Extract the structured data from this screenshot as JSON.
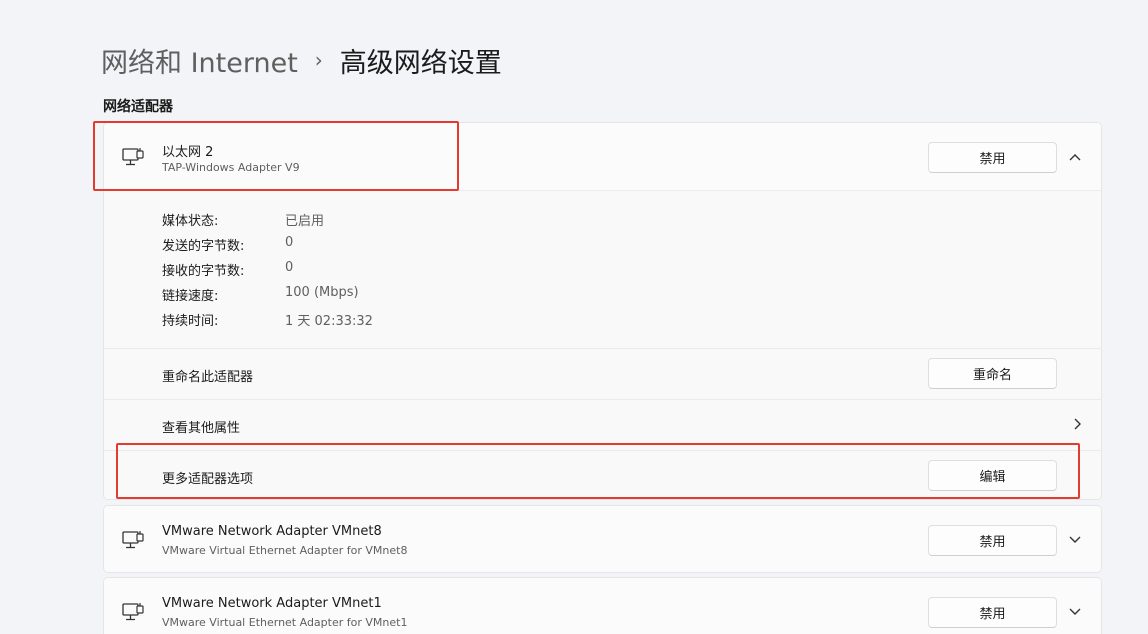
{
  "breadcrumb": {
    "parent": "网络和 Internet",
    "separator": "›",
    "current": "高级网络设置"
  },
  "section_title": "网络适配器",
  "adapters": [
    {
      "name": "以太网 2",
      "description": "TAP-Windows Adapter V9",
      "button_label": "禁用",
      "expanded": true,
      "chevron": "chevron-up-icon",
      "properties": [
        {
          "label": "媒体状态:",
          "value": "已启用"
        },
        {
          "label": "发送的字节数:",
          "value": "0"
        },
        {
          "label": "接收的字节数:",
          "value": "0"
        },
        {
          "label": "链接速度:",
          "value": "100 (Mbps)"
        },
        {
          "label": "持续时间:",
          "value": "1 天 02:33:32"
        }
      ],
      "actions": [
        {
          "label": "重命名此适配器",
          "button_label": "重命名"
        },
        {
          "label": "查看其他属性",
          "chevron": "chevron-right-icon"
        },
        {
          "label": "更多适配器选项",
          "button_label": "编辑"
        }
      ]
    },
    {
      "name": "VMware Network Adapter VMnet8",
      "description": "VMware Virtual Ethernet Adapter for VMnet8",
      "button_label": "禁用",
      "expanded": false,
      "chevron": "chevron-down-icon"
    },
    {
      "name": "VMware Network Adapter VMnet1",
      "description": "VMware Virtual Ethernet Adapter for VMnet1",
      "button_label": "禁用",
      "expanded": false,
      "chevron": "chevron-down-icon"
    }
  ],
  "colors": {
    "background": "#f3f4f7",
    "card": "#fbfbfc",
    "highlight": "#e53a2f"
  }
}
